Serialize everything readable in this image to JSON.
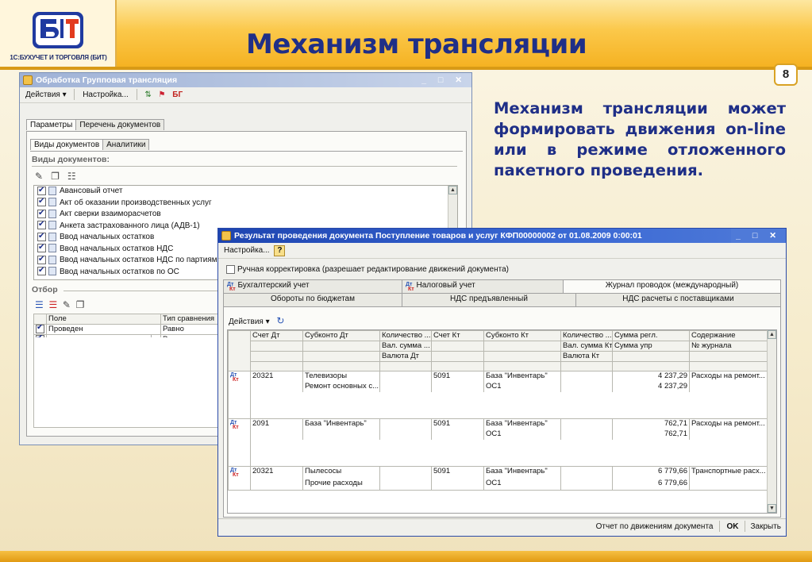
{
  "slide": {
    "title": "Механизм трансляции",
    "page_number": "8",
    "logo_text": "1С:БУХУЧЕТ И ТОРГОВЛЯ (БИТ)",
    "body_text": "Механизм трансляции может формировать движения on-line или в режиме отложенного пакетного проведения."
  },
  "win1": {
    "title": "Обработка Групповая трансляция",
    "toolbar": {
      "actions": "Действия ▾",
      "settings": "Настройка..."
    },
    "tabs": [
      "Параметры",
      "Перечень документов"
    ],
    "subtabs": [
      "Виды документов",
      "Аналитики"
    ],
    "doc_types_label": "Виды документов:",
    "doc_types": [
      "Авансовый отчет",
      "Акт об оказании производственных услуг",
      "Акт сверки взаиморасчетов",
      "Анкета застрахованного лица (АДВ-1)",
      "Ввод начальных остатков",
      "Ввод начальных остатков НДС",
      "Ввод начальных остатков НДС по партиям",
      "Ввод начальных остатков по ОС"
    ],
    "filter_label": "Отбор",
    "filter_headers": [
      "Поле",
      "Тип сравнения"
    ],
    "filter_rows": [
      {
        "field": "Проведен",
        "type": "Равно"
      },
      {
        "field": "",
        "type": "Равно"
      }
    ]
  },
  "win2": {
    "title": "Результат проведения документа Поступление товаров и услуг КФП00000002 от 01.08.2009 0:00:01",
    "toolbar_settings": "Настройка...",
    "help": "?",
    "manual_correction": "Ручная корректировка (разрешает редактирование движений документа)",
    "tabs_row1": [
      "Бухгалтерский учет",
      "Налоговый учет",
      "Журнал проводок (международный)"
    ],
    "tabs_row2": [
      "Обороты по бюджетам",
      "НДС предъявленный",
      "НДС расчеты с поставщиками"
    ],
    "inner_actions": "Действия ▾",
    "headers": {
      "debit": "Счет Дт",
      "subconto_dt": "Субконто Дт",
      "qty_dt": "Количество ...",
      "curr_sum_dt": "Вал. сумма ...",
      "currency_dt": "Валюта Дт",
      "credit": "Счет Кт",
      "subconto_kt": "Субконто Кт",
      "qty_kt": "Количество ...",
      "curr_sum_kt": "Вал. сумма Кт",
      "currency_kt": "Валюта Кт",
      "sum_reg": "Сумма регл.",
      "sum_upr": "Сумма упр",
      "content": "Содержание",
      "journal": "№ журнала"
    },
    "rows": [
      {
        "dt": "20321",
        "sub_dt_1": "Телевизоры",
        "sub_dt_2": "Ремонт основных с...",
        "kt": "5091",
        "sub_kt_1": "База \"Инвентарь\"",
        "sub_kt_2": "ОС1",
        "sum_reg": "4 237,29",
        "sum_upr": "4 237,29",
        "content": "Расходы на ремонт..."
      },
      {
        "dt": "2091",
        "sub_dt_1": "База \"Инвентарь\"",
        "sub_dt_2": "",
        "kt": "5091",
        "sub_kt_1": "База \"Инвентарь\"",
        "sub_kt_2": "ОС1",
        "sum_reg": "762,71",
        "sum_upr": "762,71",
        "content": "Расходы на ремонт..."
      },
      {
        "dt": "20321",
        "sub_dt_1": "Пылесосы",
        "sub_dt_2": "Прочие расходы",
        "kt": "5091",
        "sub_kt_1": "База \"Инвентарь\"",
        "sub_kt_2": "ОС1",
        "sum_reg": "6 779,66",
        "sum_upr": "6 779,66",
        "content": "Транспортные расх..."
      }
    ],
    "footer": {
      "report": "Отчет по движениям документа",
      "ok": "OK",
      "close": "Закрыть"
    }
  }
}
